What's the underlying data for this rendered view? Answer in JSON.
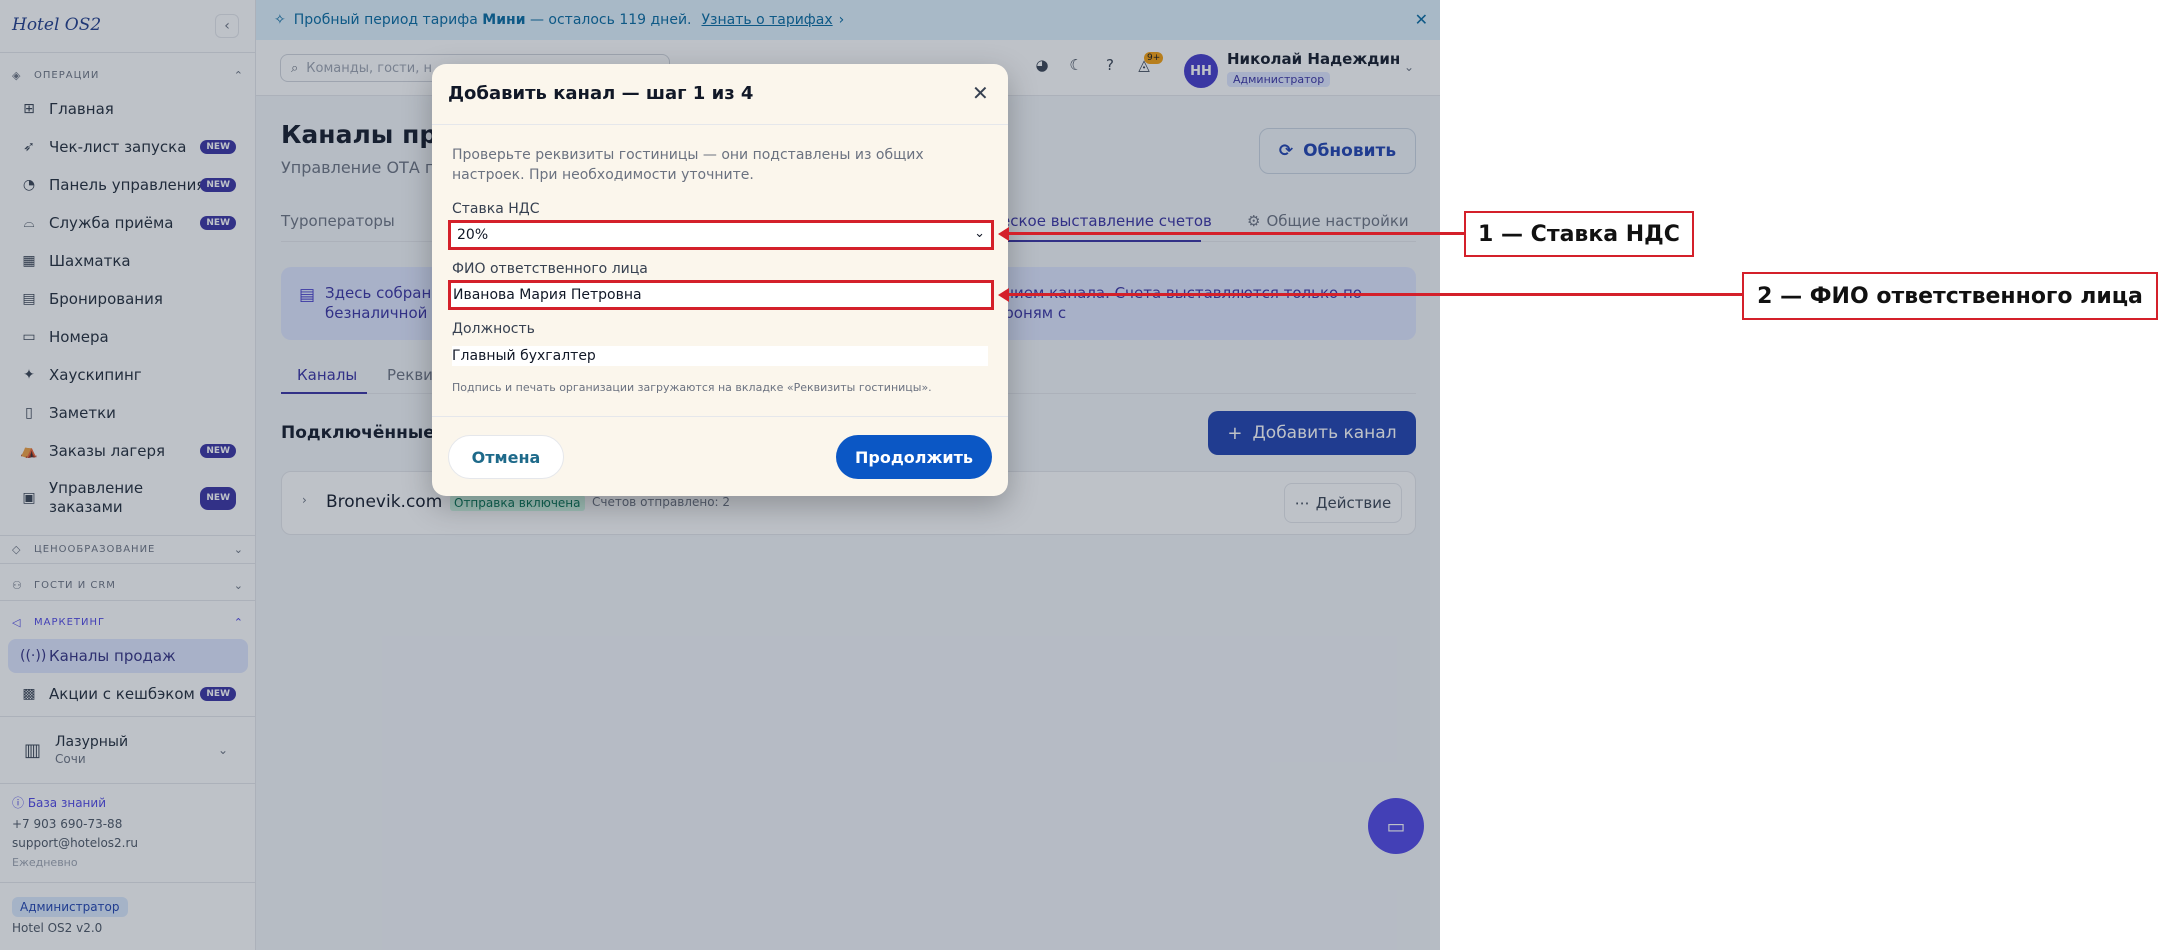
{
  "sidebar": {
    "logo": "Hotel OS2",
    "sections": {
      "operations": "ОПЕРАЦИИ",
      "pricing": "ЦЕНООБРАЗОВАНИЕ",
      "guests": "ГОСТИ И CRM",
      "marketing": "МАРКЕТИНГ"
    },
    "items": [
      {
        "label": "Главная",
        "icon": "grid-icon"
      },
      {
        "label": "Чек-лист запуска",
        "icon": "rocket-icon",
        "badge": "NEW"
      },
      {
        "label": "Панель управления",
        "icon": "gauge-icon",
        "badge": "NEW"
      },
      {
        "label": "Служба приёма",
        "icon": "bell-service-icon",
        "badge": "NEW"
      },
      {
        "label": "Шахматка",
        "icon": "table-icon"
      },
      {
        "label": "Бронирования",
        "icon": "calendar-icon"
      },
      {
        "label": "Номера",
        "icon": "bed-icon"
      },
      {
        "label": "Хаускипинг",
        "icon": "sparkle-icon"
      },
      {
        "label": "Заметки",
        "icon": "note-icon"
      },
      {
        "label": "Заказы лагеря",
        "icon": "tent-icon",
        "badge": "NEW"
      },
      {
        "label": "Управление заказами",
        "icon": "orders-icon",
        "badge": "NEW"
      },
      {
        "label": "Каналы продаж",
        "icon": "broadcast-icon"
      },
      {
        "label": "Акции с кешбэком",
        "icon": "gift-icon",
        "badge": "NEW"
      }
    ],
    "hotel": {
      "name": "Лазурный",
      "city": "Сочи"
    },
    "knowledge_base": "База знаний",
    "phone": "+7 903 690-73-88",
    "email": "support@hotelos2.ru",
    "schedule": "Ежедневно",
    "role_chip": "Администратор",
    "version": "Hotel OS2 v2.0"
  },
  "trial": {
    "prefix": "Пробный период тарифа",
    "plan": "Мини",
    "suffix": "— осталось 119 дней.",
    "link": "Узнать о тарифах"
  },
  "topbar": {
    "search_placeholder": "Команды, гости, н",
    "bell_badge": "9+",
    "avatar_initials": "НН",
    "user_name": "Николай Надеждин",
    "user_role": "Администратор"
  },
  "page": {
    "title": "Каналы прод",
    "subtitle": "Управление ОТА п",
    "refresh_label": "Обновить",
    "tabs": [
      "Туроператоры",
      "еское выставление счетов",
      "Общие настройки"
    ],
    "info_line1_left": "Здесь собраны",
    "info_line1_right": "ением канала. Счета выставляются только по броням с",
    "info_line2": "безналичной оп",
    "subtabs": [
      "Каналы",
      "Рекви"
    ],
    "section_title": "Подключённые ка",
    "add_channel_label": "Добавить канал",
    "channel": {
      "name": "Bronevik.com",
      "status": "Отправка включена",
      "count": "Счетов отправлено: 2",
      "action": "Действие"
    }
  },
  "modal": {
    "title": "Добавить канал — шаг 1 из 4",
    "description": "Проверьте реквизиты гостиницы — они подставлены из общих настроек. При необходимости уточните.",
    "vat_label": "Ставка НДС",
    "vat_value": "20%",
    "person_label": "ФИО ответственного лица",
    "person_value": "Иванова Мария Петровна",
    "position_label": "Должность",
    "position_value": "Главный бухгалтер",
    "hint": "Подпись и печать организации загружаются на вкладке «Реквизиты гостиницы».",
    "cancel_label": "Отмена",
    "continue_label": "Продолжить"
  },
  "annotations": {
    "a1": "1 — Ставка НДС",
    "a2": "2 — ФИО ответственного лица",
    "color": "#d4202a"
  }
}
